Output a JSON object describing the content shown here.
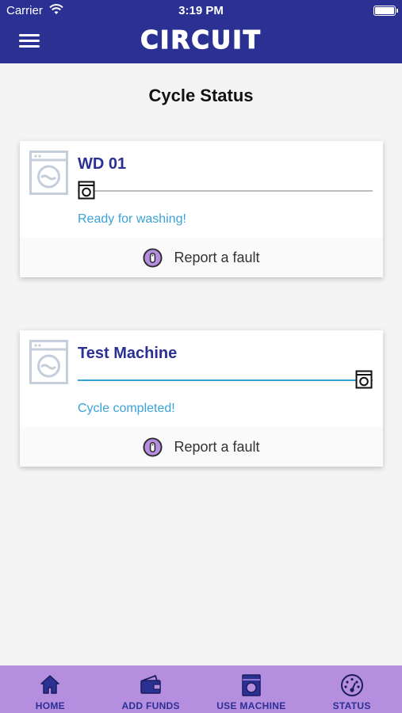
{
  "status_bar": {
    "carrier": "Carrier",
    "time": "3:19 PM"
  },
  "header": {
    "brand": "CIRCUIT",
    "menu_icon": "hamburger-menu-icon"
  },
  "page": {
    "title": "Cycle Status"
  },
  "machines": [
    {
      "name": "WD 01",
      "message": "Ready for washing!",
      "progress": 0,
      "track_color": "#bdbdbd",
      "fault_label": "Report a fault"
    },
    {
      "name": "Test Machine",
      "message": "Cycle completed!",
      "progress": 1,
      "track_color": "#3aa2d8",
      "fault_label": "Report a fault"
    }
  ],
  "bottom_nav": [
    {
      "label": "HOME",
      "icon": "home-icon"
    },
    {
      "label": "ADD FUNDS",
      "icon": "wallet-icon"
    },
    {
      "label": "USE MACHINE",
      "icon": "washing-machine-icon"
    },
    {
      "label": "STATUS",
      "icon": "gauge-icon"
    }
  ],
  "colors": {
    "brand": "#2b3093",
    "accent": "#3aa2d8",
    "nav": "#b58ee0"
  }
}
